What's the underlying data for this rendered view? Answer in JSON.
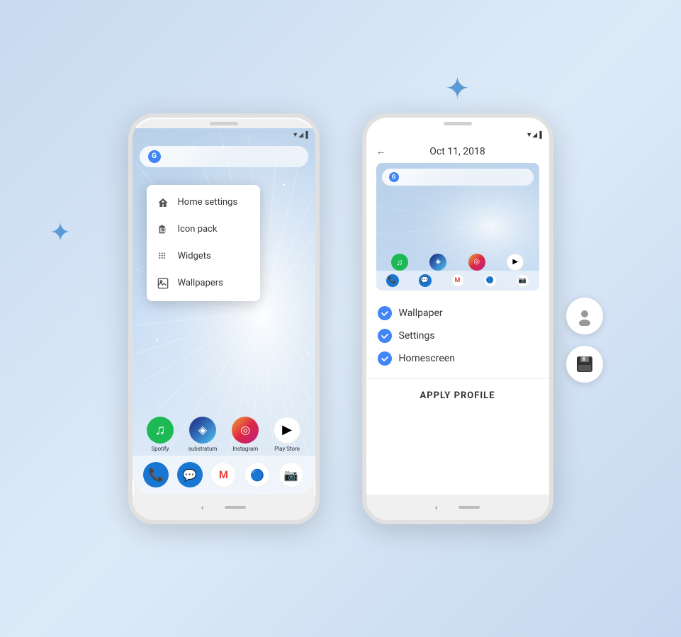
{
  "page": {
    "background": "linear-gradient(135deg, #c8daf0, #ddeaf8, #c5d8ef)"
  },
  "phone1": {
    "menu": {
      "items": [
        {
          "id": "home-settings",
          "label": "Home settings",
          "icon": "🏠"
        },
        {
          "id": "icon-pack",
          "label": "Icon pack",
          "icon": "🐴"
        },
        {
          "id": "widgets",
          "label": "Widgets",
          "icon": "⊞"
        },
        {
          "id": "wallpapers",
          "label": "Wallpapers",
          "icon": "🖼"
        }
      ]
    },
    "apps": [
      {
        "id": "spotify",
        "label": "Spotify",
        "color": "#1db954",
        "icon": "♫"
      },
      {
        "id": "substratum",
        "label": "substratum",
        "color": "#1a237e",
        "icon": "◈"
      },
      {
        "id": "instagram",
        "label": "Instagram",
        "color": "#e1306c",
        "icon": "◎"
      },
      {
        "id": "playstore",
        "label": "Play Store",
        "color": "#fff",
        "icon": "▶"
      }
    ],
    "dock": [
      {
        "id": "phone",
        "color": "#1976d2",
        "icon": "📞"
      },
      {
        "id": "messages",
        "color": "#1976d2",
        "icon": "💬"
      },
      {
        "id": "gmail",
        "color": "#fff",
        "icon": "M"
      },
      {
        "id": "chrome",
        "color": "#fff",
        "icon": "◎"
      },
      {
        "id": "camera",
        "color": "#fff",
        "icon": "📷"
      }
    ],
    "google_bar": {
      "letter": "G"
    }
  },
  "phone2": {
    "header": {
      "back_label": "←",
      "date": "Oct 11, 2018"
    },
    "checklist": {
      "items": [
        {
          "id": "wallpaper",
          "label": "Wallpaper",
          "checked": true
        },
        {
          "id": "settings",
          "label": "Settings",
          "checked": true
        },
        {
          "id": "homescreen",
          "label": "Homescreen",
          "checked": true
        }
      ]
    },
    "apply_button": "APPLY PROFILE"
  },
  "decorations": {
    "sparkle_left": "✦",
    "sparkle_right": "✦",
    "side_btn_person": "👤",
    "side_btn_save": "💾"
  }
}
